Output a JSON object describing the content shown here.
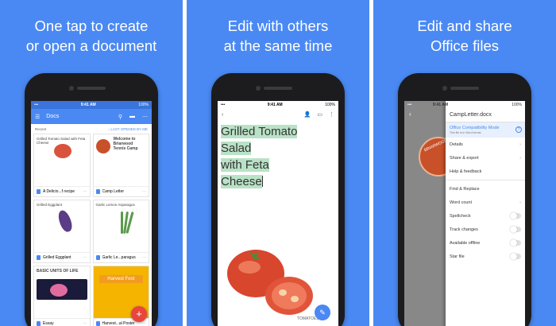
{
  "panels": [
    {
      "headline_1": "One tap to create",
      "headline_2": "or open a document"
    },
    {
      "headline_1": "Edit with others",
      "headline_2": "at the same time"
    },
    {
      "headline_1": "Edit and share",
      "headline_2": "Office files"
    }
  ],
  "status": {
    "time": "9:41 AM",
    "battery": "100%"
  },
  "docs_list": {
    "title": "Docs",
    "recent_label": "Recent",
    "sort_label": "LAST OPENED BY ME",
    "files": [
      {
        "name": "A Delicio...f recipe",
        "thumb_title": "Grilled Tomato Salad with Feta Cheese"
      },
      {
        "name": "Camp Letter",
        "thumb_title": "Welcome to Briarwood Tennis Camp"
      },
      {
        "name": "Grilled Eggplant",
        "thumb_title": "Grilled Eggplant"
      },
      {
        "name": "Garlic Le...paragus",
        "thumb_title": "Garlic Lemon Asparagus"
      },
      {
        "name": "Essay",
        "thumb_title": "BASIC UNITS OF LIFE"
      },
      {
        "name": "Harvest...al Poster",
        "thumb_title": "Harvest Fest"
      }
    ],
    "fab_label": "+"
  },
  "editor": {
    "title_lines": [
      "Grilled Tomato",
      "Salad",
      "with Feta",
      "Cheese"
    ],
    "illustration_caption": "TOMATOES"
  },
  "office_menu": {
    "file_name": "CampLetter.docx",
    "compat_title": "Office Compatibility Mode",
    "compat_sub": "This file is in Word format",
    "doc_stamp": "BRIARWOOD",
    "items_group1": [
      "Details",
      "Share & export",
      "Help & feedback"
    ],
    "items_group2": [
      "Find & Replace",
      "Word count",
      "Spellcheck",
      "Track changes",
      "Available offline",
      "Star file"
    ]
  },
  "colors": {
    "brand_blue": "#4a89f3",
    "fab_red": "#e8453c",
    "highlight_green": "#b9e2c6"
  }
}
